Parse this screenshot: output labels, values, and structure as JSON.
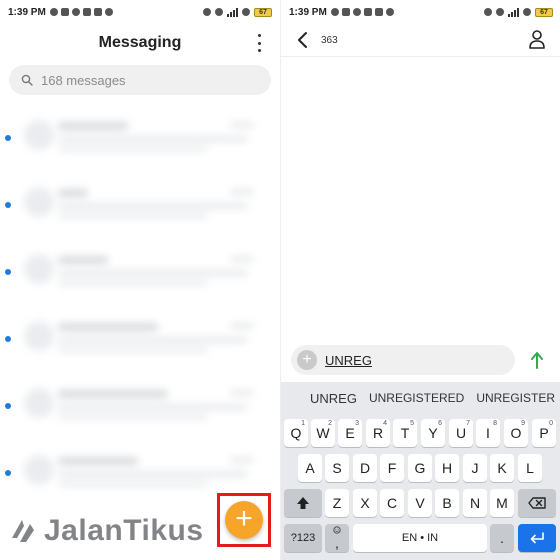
{
  "status": {
    "time": "1:39 PM",
    "battery": "67"
  },
  "messaging": {
    "title": "Messaging",
    "search_placeholder": "168 messages",
    "fab_label": "+"
  },
  "conversation": {
    "number": "363",
    "compose_value": "UNREG",
    "compose_plus": "+",
    "suggestions": [
      "UNREG",
      "UNREGISTERED",
      "UNREGISTER"
    ],
    "keys": {
      "row1": [
        "Q",
        "W",
        "E",
        "R",
        "T",
        "Y",
        "U",
        "I",
        "O",
        "P"
      ],
      "row1_sup": [
        "1",
        "2",
        "3",
        "4",
        "5",
        "6",
        "7",
        "8",
        "9",
        "0"
      ],
      "row2": [
        "A",
        "S",
        "D",
        "F",
        "G",
        "H",
        "J",
        "K",
        "L"
      ],
      "row3": [
        "Z",
        "X",
        "C",
        "V",
        "B",
        "N",
        "M"
      ],
      "symbols": "?123",
      "comma": ",",
      "space": "EN • IN",
      "period": "."
    }
  },
  "watermark": {
    "text": "JalanTikus"
  },
  "colors": {
    "accent_orange": "#f7a42b",
    "unread_blue": "#1e7be0",
    "highlight_red": "#e31b1b",
    "send_green": "#34a853",
    "enter_blue": "#1a73e8"
  },
  "icons": {
    "back": "arrow-left-icon",
    "contact": "person-icon",
    "send": "arrow-up-icon",
    "search": "search-icon",
    "menu": "kebab-menu-icon",
    "shift": "shift-icon",
    "backspace": "backspace-icon",
    "enter": "enter-icon",
    "emoji": "emoji-icon",
    "google": "google-logo-icon"
  }
}
